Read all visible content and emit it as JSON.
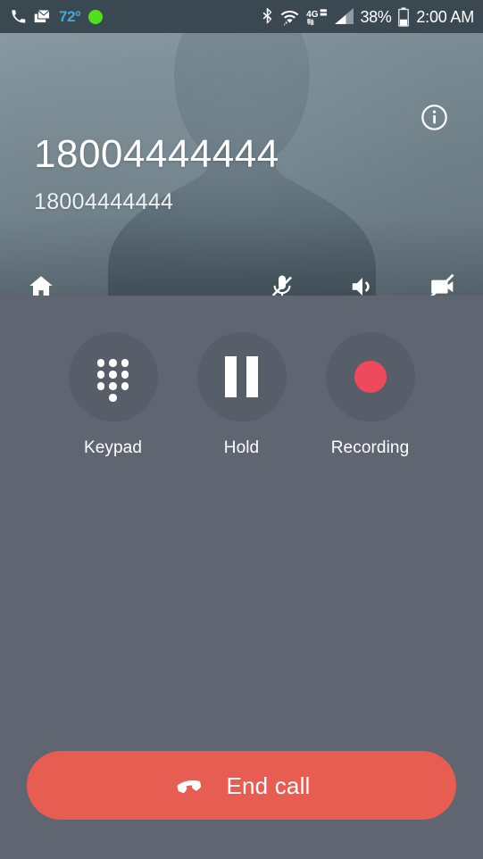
{
  "status_bar": {
    "left_icons": [
      {
        "name": "phone-icon",
        "glyph": "phone"
      },
      {
        "name": "mail-icon",
        "glyph": "envelope"
      }
    ],
    "temperature": "72º",
    "temperature_color": "#3fa9e0",
    "indicator_dot_color": "#4fe01c",
    "right_icons": [
      {
        "name": "bluetooth-icon",
        "glyph": "bluetooth"
      },
      {
        "name": "wifi-icon",
        "glyph": "wifi"
      },
      {
        "name": "network-4glte-icon",
        "glyph": "4G LTE"
      },
      {
        "name": "cellular-signal-icon",
        "glyph": "signal-bars"
      }
    ],
    "battery_percent": "38%",
    "clock": "2:00 AM",
    "background_color": "#3a4851"
  },
  "call": {
    "number_primary": "18004444444",
    "number_secondary": "18004444444",
    "info_button_label": "i",
    "photo_actions": [
      {
        "name": "home-icon",
        "label": "Home"
      },
      {
        "name": "microphone-muted-icon",
        "label": "Mute"
      },
      {
        "name": "speaker-icon",
        "label": "Speaker"
      },
      {
        "name": "video-off-icon",
        "label": "Video off"
      }
    ]
  },
  "controls": [
    {
      "label": "Keypad",
      "icon": "dialpad-icon"
    },
    {
      "label": "Hold",
      "icon": "pause-icon"
    },
    {
      "label": "Recording",
      "icon": "record-dot-icon"
    }
  ],
  "end_call": {
    "label": "End call",
    "icon": "end-call-handset-icon",
    "color": "#e85d52"
  },
  "colors": {
    "panel_background": "#5f6571",
    "control_circle": "#585e69",
    "record_dot": "#ef4a5c",
    "photo_gradient_top": "#8a9aa2",
    "photo_gradient_bottom": "#6e7d86"
  }
}
